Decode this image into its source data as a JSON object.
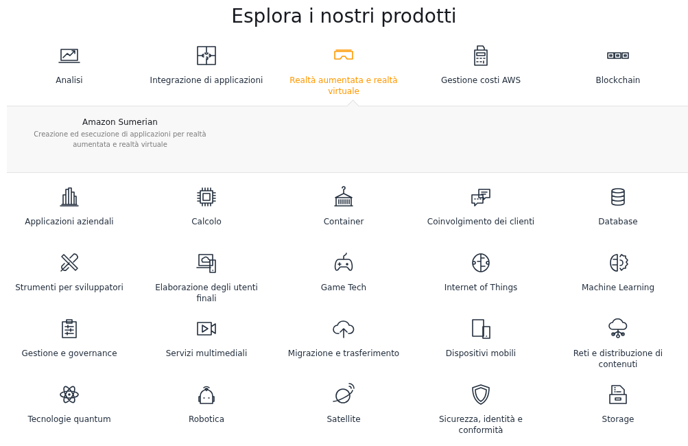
{
  "title": "Esplora i nostri prodotti",
  "categories": [
    {
      "label": "Analisi",
      "selected": false
    },
    {
      "label": "Integrazione di applicazioni",
      "selected": false
    },
    {
      "label": "Realtà aumentata e realtà virtuale",
      "selected": true
    },
    {
      "label": "Gestione costi AWS",
      "selected": false
    },
    {
      "label": "Blockchain",
      "selected": false
    },
    {
      "label": "Applicazioni aziendali",
      "selected": false
    },
    {
      "label": "Calcolo",
      "selected": false
    },
    {
      "label": "Container",
      "selected": false
    },
    {
      "label": "Coinvolgimento dei clienti",
      "selected": false
    },
    {
      "label": "Database",
      "selected": false
    },
    {
      "label": "Strumenti per sviluppatori",
      "selected": false
    },
    {
      "label": "Elaborazione degli utenti finali",
      "selected": false
    },
    {
      "label": "Game Tech",
      "selected": false
    },
    {
      "label": "Internet of Things",
      "selected": false
    },
    {
      "label": "Machine Learning",
      "selected": false
    },
    {
      "label": "Gestione e governance",
      "selected": false
    },
    {
      "label": "Servizi multimediali",
      "selected": false
    },
    {
      "label": "Migrazione e trasferimento",
      "selected": false
    },
    {
      "label": "Dispositivi mobili",
      "selected": false
    },
    {
      "label": "Reti e distribuzione di contenuti",
      "selected": false
    },
    {
      "label": "Tecnologie quantum",
      "selected": false
    },
    {
      "label": "Robotica",
      "selected": false
    },
    {
      "label": "Satellite",
      "selected": false
    },
    {
      "label": "Sicurezza, identità e conformità",
      "selected": false
    },
    {
      "label": "Storage",
      "selected": false
    }
  ],
  "panel": {
    "products": [
      {
        "name": "Amazon Sumerian",
        "description": "Creazione ed esecuzione di applicazioni per realtà aumentata e realtà virtuale"
      }
    ]
  }
}
